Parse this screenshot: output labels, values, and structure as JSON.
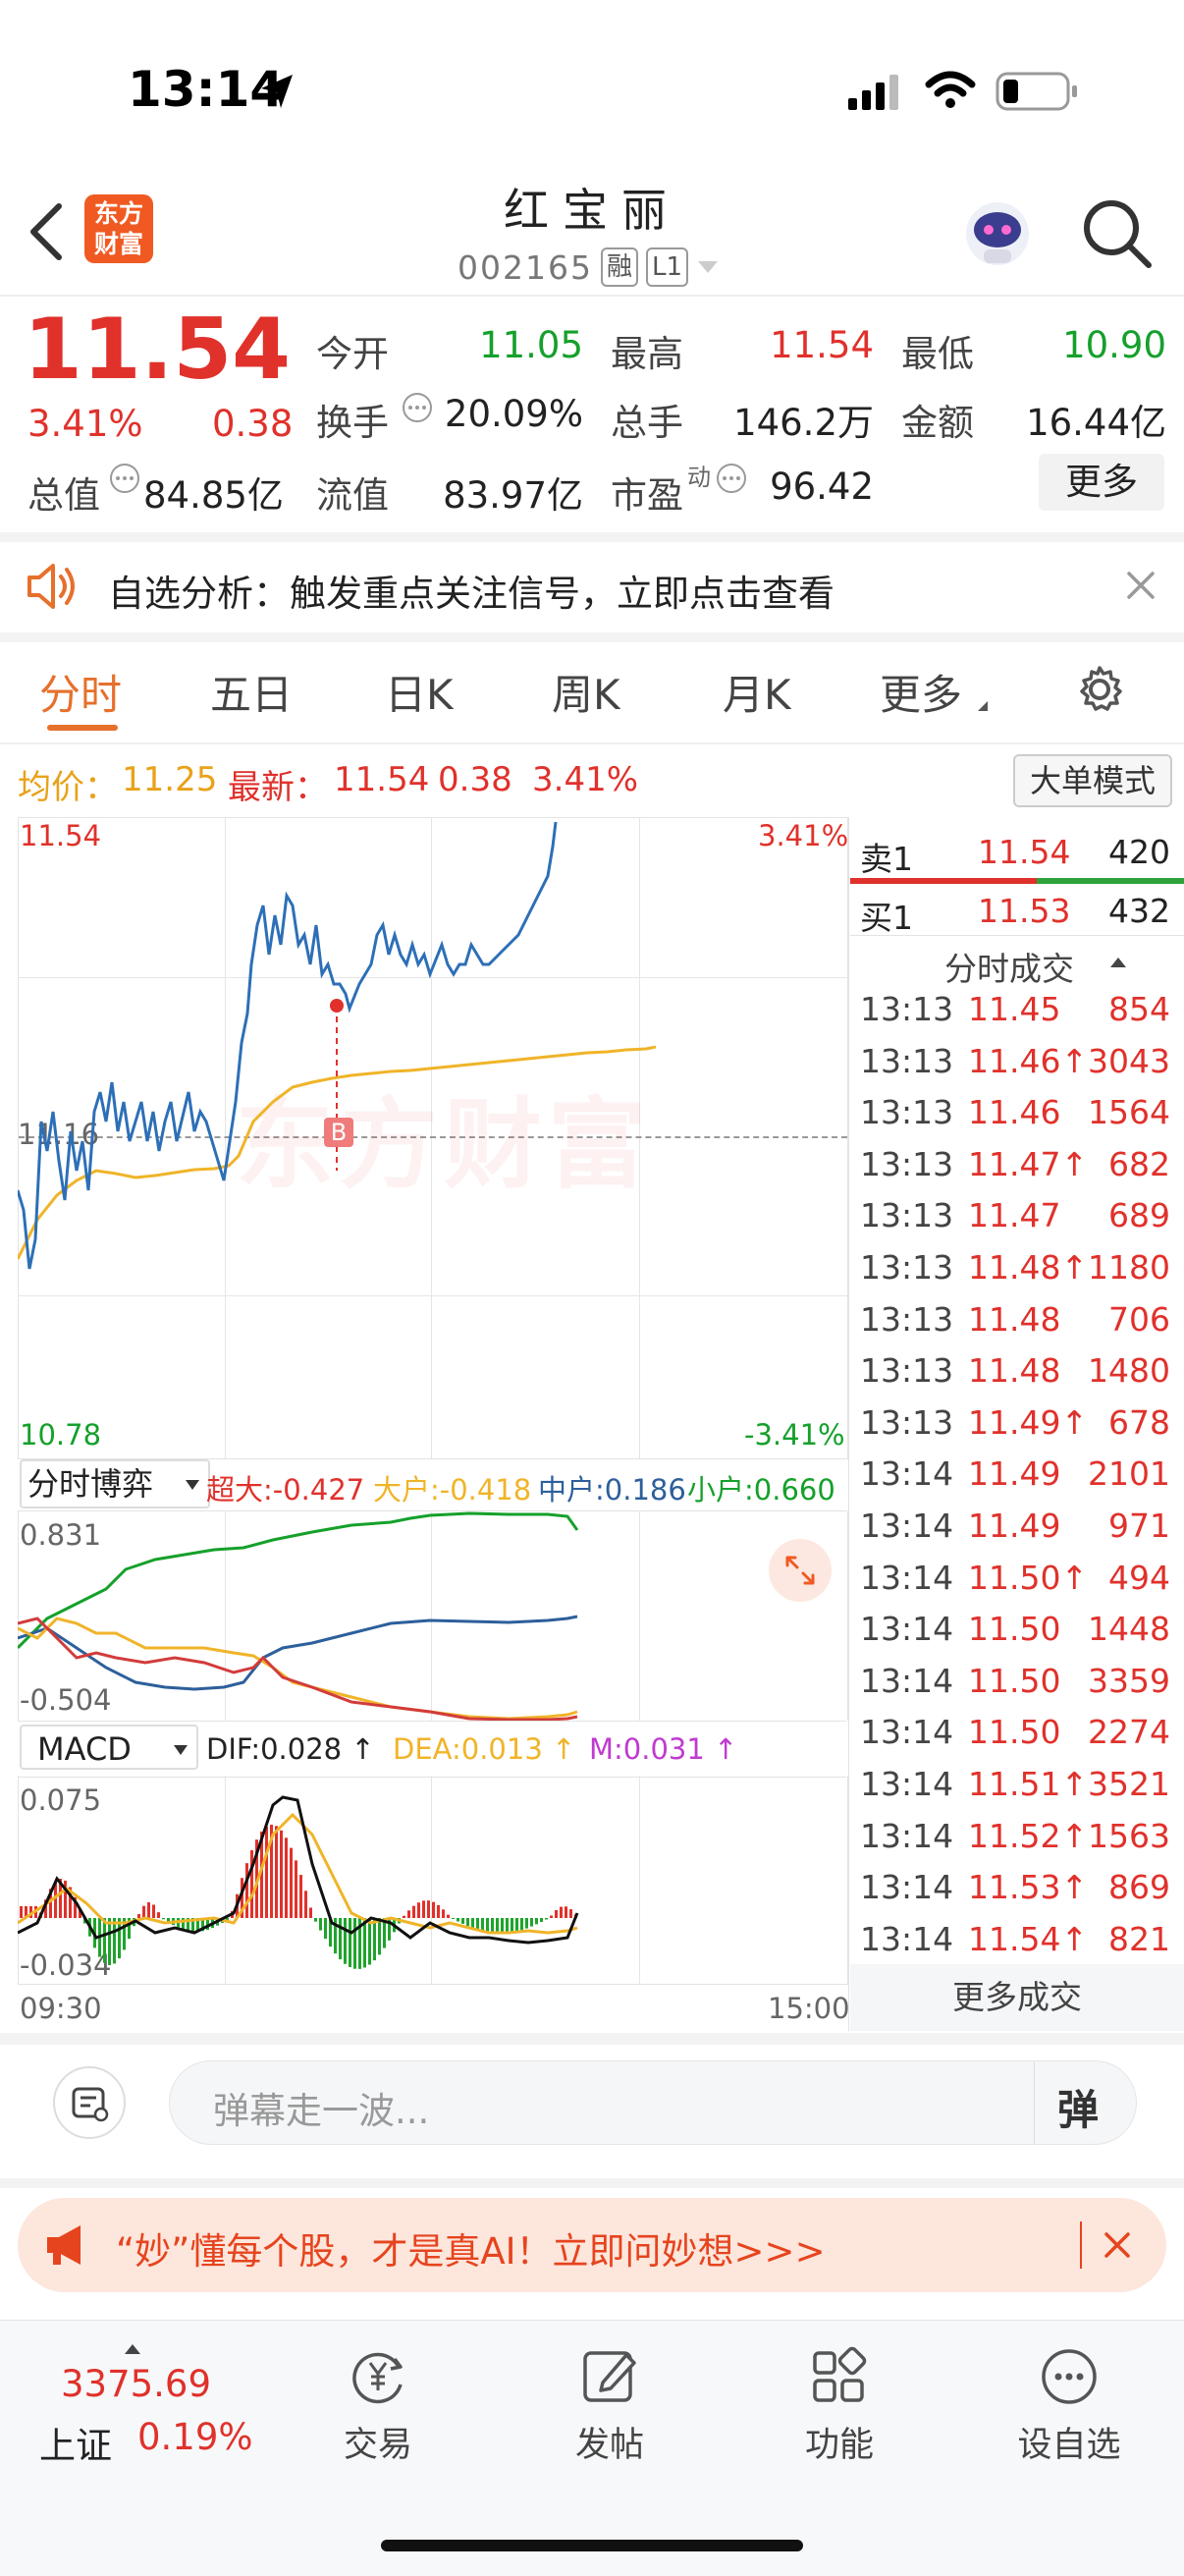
{
  "status_bar": {
    "time": "13:14"
  },
  "header": {
    "app_logo_line1": "东方",
    "app_logo_line2": "财富",
    "title": "红宝丽",
    "code": "002165",
    "tag_margin": "融",
    "tag_level": "L1"
  },
  "quote": {
    "price": "11.54",
    "change_pct": "3.41%",
    "change": "0.38",
    "open_label": "今开",
    "open": "11.05",
    "high_label": "最高",
    "high": "11.54",
    "low_label": "最低",
    "low": "10.90",
    "turnover_label": "换手",
    "turnover": "20.09%",
    "volume_label": "总手",
    "volume": "146.2万",
    "amount_label": "金额",
    "amount": "16.44亿",
    "mktcap_label": "总值",
    "mktcap": "84.85亿",
    "float_label": "流值",
    "float": "83.97亿",
    "pe_label": "市盈",
    "pe_sup": "动",
    "pe": "96.42",
    "more_button": "更多"
  },
  "notice": {
    "text": "自选分析：触发重点关注信号，立即点击查看"
  },
  "tabs": [
    "分时",
    "五日",
    "日K",
    "周K",
    "月K",
    "更多"
  ],
  "chart_info": {
    "avg_label": "均价：",
    "avg": "11.25",
    "latest_label": "最新：",
    "latest": "11.54",
    "latest_change": "0.38",
    "latest_pct": "3.41%",
    "mode_button": "大单模式",
    "y_top": "11.54",
    "y_pct_top": "3.41%",
    "y_mid": "11.16",
    "y_bottom": "10.78",
    "y_pct_bottom": "-3.41%",
    "marker_label": "B",
    "watermark": "东方财富"
  },
  "flow": {
    "selector": "分时博弈",
    "super_large": "超大:-0.427",
    "large": "大户:-0.418",
    "medium": "中户:0.186",
    "small": "小户:0.660",
    "y_top": "0.831",
    "y_bottom": "-0.504"
  },
  "macd": {
    "selector": "MACD",
    "dif": "DIF:0.028 ↑",
    "dea": "DEA:0.013 ↑",
    "m": "M:0.031 ↑",
    "y_top": "0.075",
    "y_bottom": "-0.034",
    "x_start": "09:30",
    "x_end": "15:00"
  },
  "order_book": {
    "sell_label": "卖1",
    "sell_price": "11.54",
    "sell_vol": "420",
    "buy_label": "买1",
    "buy_price": "11.53",
    "buy_vol": "432",
    "trades_title": "分时成交",
    "more_trades": "更多成交",
    "trades": [
      {
        "time": "13:13",
        "price": "11.45",
        "vol": "854"
      },
      {
        "time": "13:13",
        "price": "11.46↑",
        "vol": "3043"
      },
      {
        "time": "13:13",
        "price": "11.46",
        "vol": "1564"
      },
      {
        "time": "13:13",
        "price": "11.47↑",
        "vol": "682"
      },
      {
        "time": "13:13",
        "price": "11.47",
        "vol": "689"
      },
      {
        "time": "13:13",
        "price": "11.48↑",
        "vol": "1180"
      },
      {
        "time": "13:13",
        "price": "11.48",
        "vol": "706"
      },
      {
        "time": "13:13",
        "price": "11.48",
        "vol": "1480"
      },
      {
        "time": "13:13",
        "price": "11.49↑",
        "vol": "678"
      },
      {
        "time": "13:14",
        "price": "11.49",
        "vol": "2101"
      },
      {
        "time": "13:14",
        "price": "11.49",
        "vol": "971"
      },
      {
        "time": "13:14",
        "price": "11.50↑",
        "vol": "494"
      },
      {
        "time": "13:14",
        "price": "11.50",
        "vol": "1448"
      },
      {
        "time": "13:14",
        "price": "11.50",
        "vol": "3359"
      },
      {
        "time": "13:14",
        "price": "11.50",
        "vol": "2274"
      },
      {
        "time": "13:14",
        "price": "11.51↑",
        "vol": "3521"
      },
      {
        "time": "13:14",
        "price": "11.52↑",
        "vol": "1563"
      },
      {
        "time": "13:14",
        "price": "11.53↑",
        "vol": "869"
      },
      {
        "time": "13:14",
        "price": "11.54↑",
        "vol": "821"
      }
    ]
  },
  "comment_bar": {
    "placeholder": "弹幕走一波...",
    "danmu_button": "弹"
  },
  "ad_banner": {
    "text": "“妙”懂每个股，才是真AI！立即问妙想>>>"
  },
  "bottom_nav": {
    "index_value": "3375.69",
    "index_name": "上证",
    "index_pct": "0.19%",
    "items": [
      "交易",
      "发帖",
      "功能",
      "设自选"
    ]
  }
}
